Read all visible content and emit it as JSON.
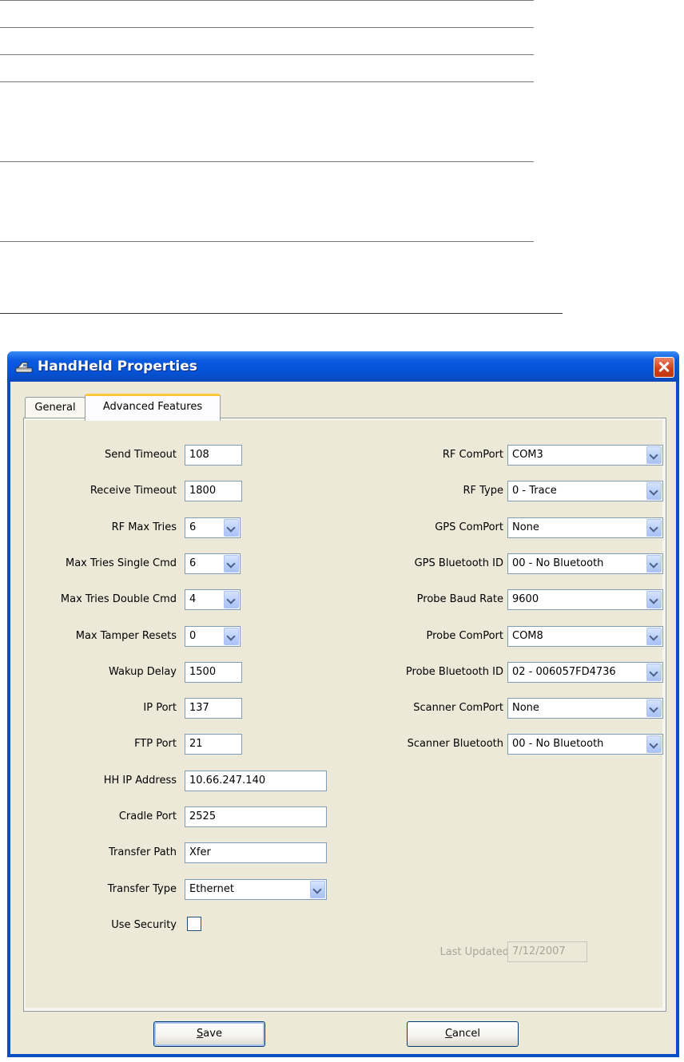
{
  "window": {
    "title": "HandHeld Properties"
  },
  "tabs": [
    {
      "label": "General"
    },
    {
      "label": "Advanced Features"
    }
  ],
  "left_fields": [
    {
      "label": "Send Timeout",
      "value": "108",
      "kind": "text"
    },
    {
      "label": "Receive Timeout",
      "value": "1800",
      "kind": "text"
    },
    {
      "label": "RF Max Tries",
      "value": "6",
      "kind": "combo"
    },
    {
      "label": "Max Tries Single Cmd",
      "value": "6",
      "kind": "combo"
    },
    {
      "label": "Max Tries Double Cmd",
      "value": "4",
      "kind": "combo"
    },
    {
      "label": "Max Tamper Resets",
      "value": "0",
      "kind": "combo"
    },
    {
      "label": "Wakup Delay",
      "value": "1500",
      "kind": "text"
    },
    {
      "label": "IP Port",
      "value": "137",
      "kind": "text"
    },
    {
      "label": "FTP Port",
      "value": "21",
      "kind": "text"
    },
    {
      "label": "HH IP Address",
      "value": "10.66.247.140",
      "kind": "text"
    },
    {
      "label": "Cradle Port",
      "value": "2525",
      "kind": "text"
    },
    {
      "label": "Transfer Path",
      "value": "Xfer",
      "kind": "text"
    },
    {
      "label": "Transfer Type",
      "value": "Ethernet",
      "kind": "combo"
    },
    {
      "label": "Use Security",
      "checked": false,
      "kind": "checkbox"
    }
  ],
  "right_fields": [
    {
      "label": "RF ComPort",
      "value": "COM3"
    },
    {
      "label": "RF Type",
      "value": "0 - Trace"
    },
    {
      "label": "GPS ComPort",
      "value": "None"
    },
    {
      "label": "GPS Bluetooth ID",
      "value": "00 - No Bluetooth"
    },
    {
      "label": "Probe Baud Rate",
      "value": "9600"
    },
    {
      "label": "Probe ComPort",
      "value": "COM8"
    },
    {
      "label": "Probe Bluetooth ID",
      "value": "02 - 006057FD4736"
    },
    {
      "label": "Scanner ComPort",
      "value": "None"
    },
    {
      "label": "Scanner Bluetooth",
      "value": "00 - No Bluetooth"
    }
  ],
  "last_updated": {
    "label": "Last Updated",
    "value": "7/12/2007"
  },
  "buttons": {
    "save": {
      "mnemonic": "S",
      "rest": "ave"
    },
    "cancel": {
      "mnemonic": "C",
      "rest": "ancel"
    }
  },
  "colors": {
    "title_bar": "#0a5be0",
    "dialog_bg": "#ece9d8",
    "tab_highlight": "#ffc83c",
    "close_button": "#d0411c"
  }
}
